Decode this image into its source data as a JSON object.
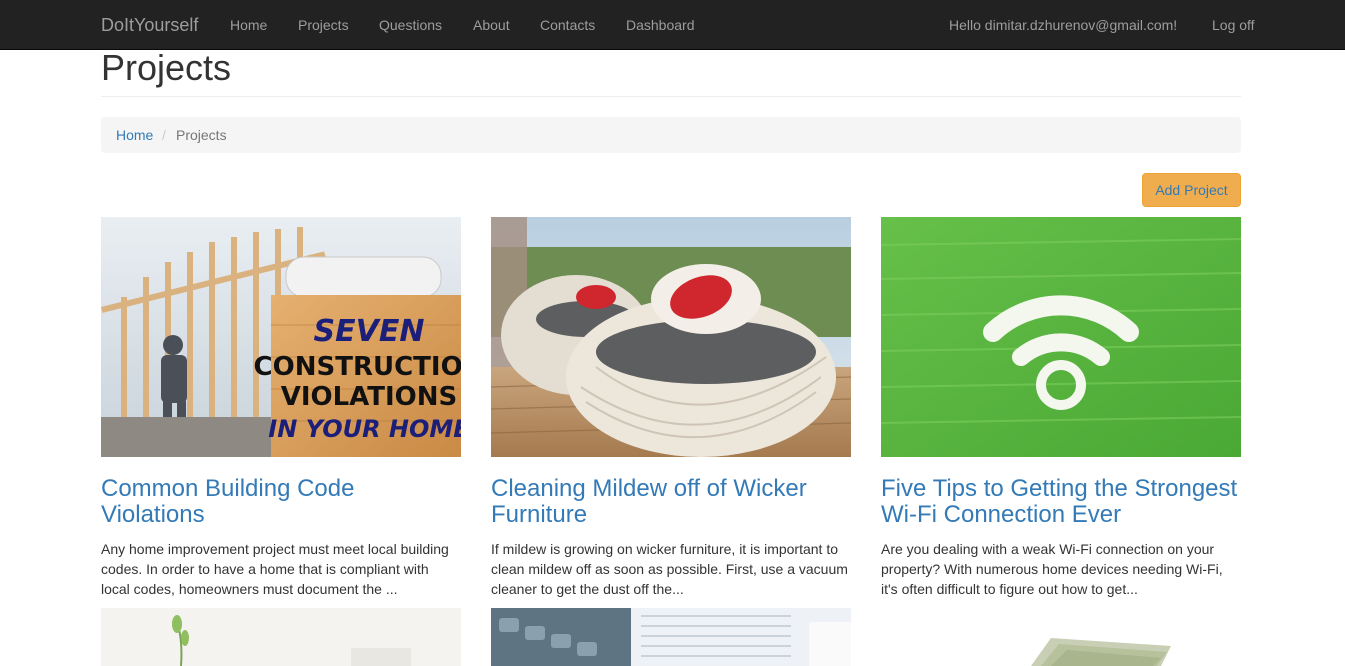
{
  "navbar": {
    "brand": "DoItYourself",
    "links": [
      "Home",
      "Projects",
      "Questions",
      "About",
      "Contacts",
      "Dashboard"
    ],
    "greeting": "Hello dimitar.dzhurenov@gmail.com!",
    "logoff": "Log off"
  },
  "page": {
    "title": "Projects"
  },
  "breadcrumb": {
    "home": "Home",
    "separator": "/",
    "current": "Projects"
  },
  "actions": {
    "add_project": "Add Project"
  },
  "projects": [
    {
      "title": "Common Building Code Violations",
      "summary": "Any home improvement project must meet local building codes. In order to have a home that is compliant with local codes, homeowners must document the ...",
      "image_text": [
        "SEVEN",
        "CONSTRUCTION",
        "VIOLATIONS",
        "IN YOUR HOME"
      ]
    },
    {
      "title": "Cleaning Mildew off of Wicker Furniture",
      "summary": "If mildew is growing on wicker furniture, it is important to clean mildew off as soon as possible. First, use a vacuum cleaner to get the dust off the..."
    },
    {
      "title": "Five Tips to Getting the Strongest Wi-Fi Connection Ever",
      "summary": "Are you dealing with a weak Wi-Fi connection on your property? With numerous home devices needing Wi-Fi, it's often difficult to figure out how to get..."
    }
  ],
  "colors": {
    "navbar_bg": "#222222",
    "link": "#337ab7",
    "warning_btn": "#f0ad4e"
  }
}
